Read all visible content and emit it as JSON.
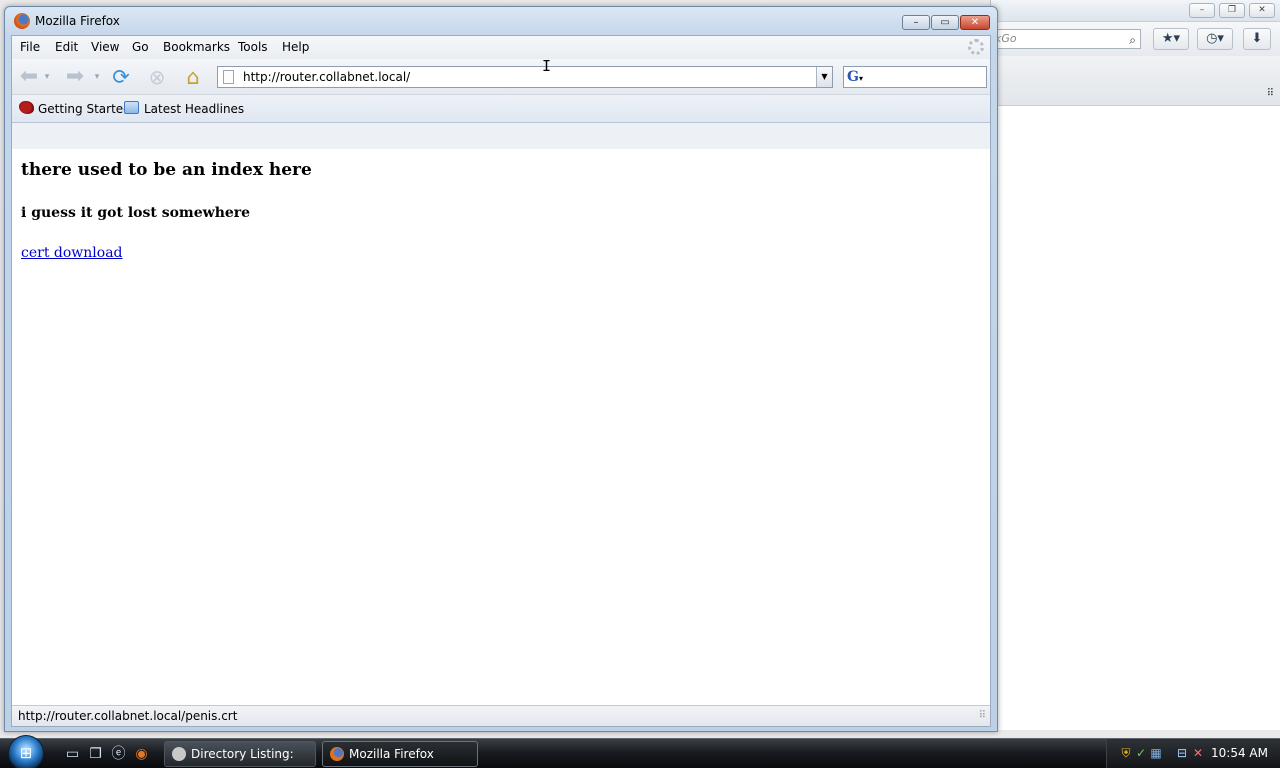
{
  "background_window": {
    "search_placeholder": "kGo",
    "search_icon": "search-icon",
    "caption_buttons": [
      "minimize",
      "restore",
      "close"
    ]
  },
  "window": {
    "title": "Mozilla Firefox",
    "caption_buttons": [
      "minimize",
      "maximize",
      "close"
    ]
  },
  "menu": {
    "items": [
      "File",
      "Edit",
      "View",
      "Go",
      "Bookmarks",
      "Tools",
      "Help"
    ]
  },
  "navigation": {
    "url": "http://router.collabnet.local/",
    "search_value": ""
  },
  "bookmarks": {
    "items": [
      "Getting Started",
      "Latest Headlines"
    ]
  },
  "page": {
    "heading": "there used to be an index here",
    "subheading": "i guess it got lost somewhere",
    "link_text": "cert download"
  },
  "status": {
    "text": "http://router.collabnet.local/penis.crt"
  },
  "taskbar": {
    "tasks": [
      {
        "label": "Directory Listing: /p...",
        "active": false
      },
      {
        "label": "Mozilla Firefox",
        "active": true
      }
    ],
    "clock": "10:54 AM"
  }
}
